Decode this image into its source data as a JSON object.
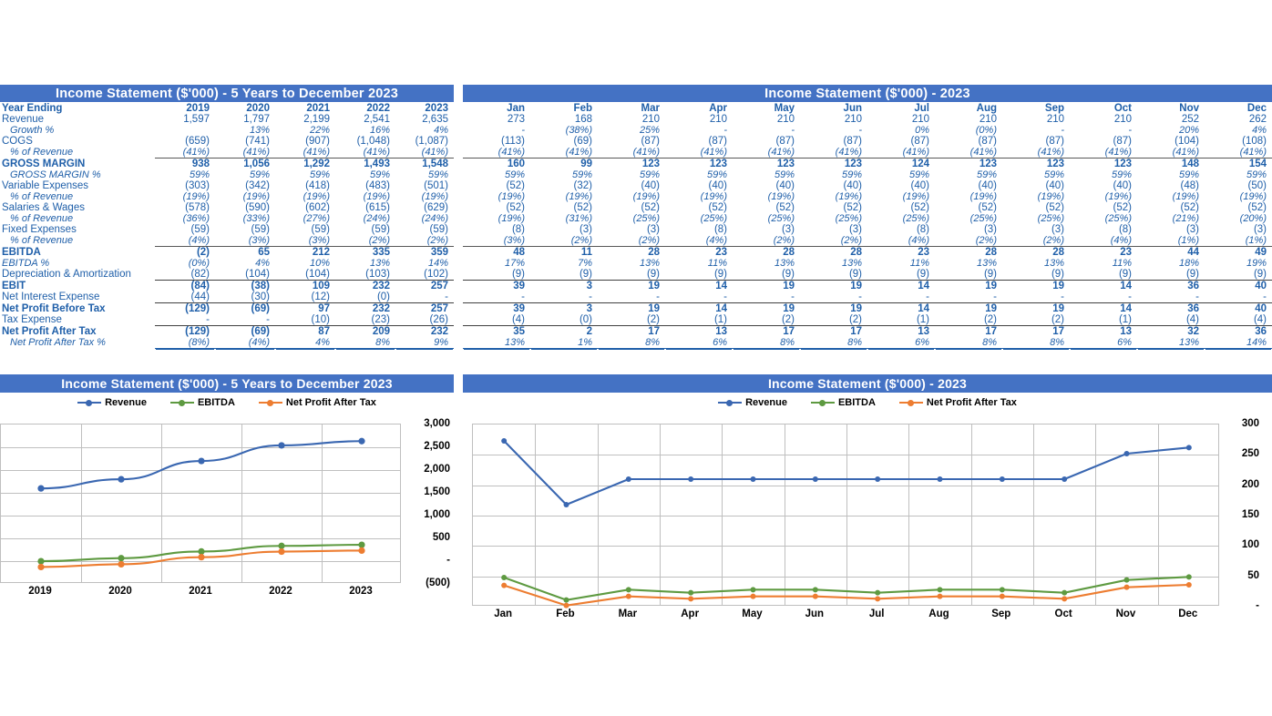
{
  "colors": {
    "header_blue": "#4472C4",
    "text_blue": "#1F5FA9",
    "revenue": "#3A67B1",
    "ebitda": "#5E9A41",
    "npat": "#ED7D31"
  },
  "annual_panel": {
    "title": "Income Statement ($'000) - 5 Years to December 2023",
    "row_header_label": "Year Ending",
    "columns": [
      "2019",
      "2020",
      "2021",
      "2022",
      "2023"
    ],
    "rows": [
      {
        "label": "Revenue",
        "style": "norm",
        "values": [
          "1,597",
          "1,797",
          "2,199",
          "2,541",
          "2,635"
        ]
      },
      {
        "label": "Growth %",
        "style": "ital-ind",
        "values": [
          "",
          "13%",
          "22%",
          "16%",
          "4%"
        ]
      },
      {
        "label": "COGS",
        "style": "norm",
        "values": [
          "(659)",
          "(741)",
          "(907)",
          "(1,048)",
          "(1,087)"
        ]
      },
      {
        "label": "% of Revenue",
        "style": "ital-ind",
        "values": [
          "(41%)",
          "(41%)",
          "(41%)",
          "(41%)",
          "(41%)"
        ]
      },
      {
        "label": "GROSS MARGIN",
        "style": "bold-top",
        "values": [
          "938",
          "1,056",
          "1,292",
          "1,493",
          "1,548"
        ]
      },
      {
        "label": "GROSS MARGIN %",
        "style": "ital-ind",
        "values": [
          "59%",
          "59%",
          "59%",
          "59%",
          "59%"
        ]
      },
      {
        "label": "Variable Expenses",
        "style": "norm",
        "values": [
          "(303)",
          "(342)",
          "(418)",
          "(483)",
          "(501)"
        ]
      },
      {
        "label": "% of Revenue",
        "style": "ital-ind",
        "values": [
          "(19%)",
          "(19%)",
          "(19%)",
          "(19%)",
          "(19%)"
        ]
      },
      {
        "label": "Salaries & Wages",
        "style": "norm",
        "values": [
          "(578)",
          "(590)",
          "(602)",
          "(615)",
          "(629)"
        ]
      },
      {
        "label": "% of Revenue",
        "style": "ital-ind",
        "values": [
          "(36%)",
          "(33%)",
          "(27%)",
          "(24%)",
          "(24%)"
        ]
      },
      {
        "label": "Fixed Expenses",
        "style": "norm",
        "values": [
          "(59)",
          "(59)",
          "(59)",
          "(59)",
          "(59)"
        ]
      },
      {
        "label": "% of Revenue",
        "style": "ital-ind",
        "values": [
          "(4%)",
          "(3%)",
          "(3%)",
          "(2%)",
          "(2%)"
        ]
      },
      {
        "label": "EBITDA",
        "style": "bold-top",
        "values": [
          "(2)",
          "65",
          "212",
          "335",
          "359"
        ]
      },
      {
        "label": "EBITDA %",
        "style": "ital",
        "values": [
          "(0%)",
          "4%",
          "10%",
          "13%",
          "14%"
        ]
      },
      {
        "label": "Depreciation & Amortization",
        "style": "norm",
        "values": [
          "(82)",
          "(104)",
          "(104)",
          "(103)",
          "(102)"
        ]
      },
      {
        "label": "EBIT",
        "style": "bold-thin",
        "values": [
          "(84)",
          "(38)",
          "109",
          "232",
          "257"
        ]
      },
      {
        "label": "Net Interest Expense",
        "style": "norm",
        "values": [
          "(44)",
          "(30)",
          "(12)",
          "(0)",
          "-"
        ]
      },
      {
        "label": "Net Profit Before Tax",
        "style": "bold-thin",
        "values": [
          "(129)",
          "(69)",
          "97",
          "232",
          "257"
        ]
      },
      {
        "label": "Tax Expense",
        "style": "norm",
        "values": [
          "-",
          "-",
          "(10)",
          "(23)",
          "(26)"
        ]
      },
      {
        "label": "Net Profit After Tax",
        "style": "bold-thin",
        "values": [
          "(129)",
          "(69)",
          "87",
          "209",
          "232"
        ]
      },
      {
        "label": "Net Profit After Tax %",
        "style": "ital-ind-dbl",
        "values": [
          "(8%)",
          "(4%)",
          "4%",
          "8%",
          "9%"
        ]
      }
    ]
  },
  "monthly_panel": {
    "title": "Income Statement ($'000) - 2023",
    "columns": [
      "Jan",
      "Feb",
      "Mar",
      "Apr",
      "May",
      "Jun",
      "Jul",
      "Aug",
      "Sep",
      "Oct",
      "Nov",
      "Dec"
    ],
    "rows": [
      {
        "label": "Revenue",
        "style": "norm",
        "values": [
          "273",
          "168",
          "210",
          "210",
          "210",
          "210",
          "210",
          "210",
          "210",
          "210",
          "252",
          "262"
        ]
      },
      {
        "label": "Growth %",
        "style": "ital-ind",
        "values": [
          "-",
          "(38%)",
          "25%",
          "-",
          "-",
          "-",
          "0%",
          "(0%)",
          "-",
          "-",
          "20%",
          "4%"
        ]
      },
      {
        "label": "COGS",
        "style": "norm",
        "values": [
          "(113)",
          "(69)",
          "(87)",
          "(87)",
          "(87)",
          "(87)",
          "(87)",
          "(87)",
          "(87)",
          "(87)",
          "(104)",
          "(108)"
        ]
      },
      {
        "label": "% of Revenue",
        "style": "ital-ind",
        "values": [
          "(41%)",
          "(41%)",
          "(41%)",
          "(41%)",
          "(41%)",
          "(41%)",
          "(41%)",
          "(41%)",
          "(41%)",
          "(41%)",
          "(41%)",
          "(41%)"
        ]
      },
      {
        "label": "GROSS MARGIN",
        "style": "bold-top",
        "values": [
          "160",
          "99",
          "123",
          "123",
          "123",
          "123",
          "124",
          "123",
          "123",
          "123",
          "148",
          "154"
        ]
      },
      {
        "label": "GROSS MARGIN %",
        "style": "ital-ind",
        "values": [
          "59%",
          "59%",
          "59%",
          "59%",
          "59%",
          "59%",
          "59%",
          "59%",
          "59%",
          "59%",
          "59%",
          "59%"
        ]
      },
      {
        "label": "Variable Expenses",
        "style": "norm",
        "values": [
          "(52)",
          "(32)",
          "(40)",
          "(40)",
          "(40)",
          "(40)",
          "(40)",
          "(40)",
          "(40)",
          "(40)",
          "(48)",
          "(50)"
        ]
      },
      {
        "label": "% of Revenue",
        "style": "ital-ind",
        "values": [
          "(19%)",
          "(19%)",
          "(19%)",
          "(19%)",
          "(19%)",
          "(19%)",
          "(19%)",
          "(19%)",
          "(19%)",
          "(19%)",
          "(19%)",
          "(19%)"
        ]
      },
      {
        "label": "Salaries & Wages",
        "style": "norm",
        "values": [
          "(52)",
          "(52)",
          "(52)",
          "(52)",
          "(52)",
          "(52)",
          "(52)",
          "(52)",
          "(52)",
          "(52)",
          "(52)",
          "(52)"
        ]
      },
      {
        "label": "% of Revenue",
        "style": "ital-ind",
        "values": [
          "(19%)",
          "(31%)",
          "(25%)",
          "(25%)",
          "(25%)",
          "(25%)",
          "(25%)",
          "(25%)",
          "(25%)",
          "(25%)",
          "(21%)",
          "(20%)"
        ]
      },
      {
        "label": "Fixed Expenses",
        "style": "norm",
        "values": [
          "(8)",
          "(3)",
          "(3)",
          "(8)",
          "(3)",
          "(3)",
          "(8)",
          "(3)",
          "(3)",
          "(8)",
          "(3)",
          "(3)"
        ]
      },
      {
        "label": "% of Revenue",
        "style": "ital-ind",
        "values": [
          "(3%)",
          "(2%)",
          "(2%)",
          "(4%)",
          "(2%)",
          "(2%)",
          "(4%)",
          "(2%)",
          "(2%)",
          "(4%)",
          "(1%)",
          "(1%)"
        ]
      },
      {
        "label": "EBITDA",
        "style": "bold-top",
        "values": [
          "48",
          "11",
          "28",
          "23",
          "28",
          "28",
          "23",
          "28",
          "28",
          "23",
          "44",
          "49"
        ]
      },
      {
        "label": "EBITDA %",
        "style": "ital",
        "values": [
          "17%",
          "7%",
          "13%",
          "11%",
          "13%",
          "13%",
          "11%",
          "13%",
          "13%",
          "11%",
          "18%",
          "19%"
        ]
      },
      {
        "label": "Depreciation & Amortization",
        "style": "norm",
        "values": [
          "(9)",
          "(9)",
          "(9)",
          "(9)",
          "(9)",
          "(9)",
          "(9)",
          "(9)",
          "(9)",
          "(9)",
          "(9)",
          "(9)"
        ]
      },
      {
        "label": "EBIT",
        "style": "bold-thin",
        "values": [
          "39",
          "3",
          "19",
          "14",
          "19",
          "19",
          "14",
          "19",
          "19",
          "14",
          "36",
          "40"
        ]
      },
      {
        "label": "Net Interest Expense",
        "style": "norm",
        "values": [
          "-",
          "-",
          "-",
          "-",
          "-",
          "-",
          "-",
          "-",
          "-",
          "-",
          "-",
          "-"
        ]
      },
      {
        "label": "Net Profit Before Tax",
        "style": "bold-thin",
        "values": [
          "39",
          "3",
          "19",
          "14",
          "19",
          "19",
          "14",
          "19",
          "19",
          "14",
          "36",
          "40"
        ]
      },
      {
        "label": "Tax Expense",
        "style": "norm",
        "values": [
          "(4)",
          "(0)",
          "(2)",
          "(1)",
          "(2)",
          "(2)",
          "(1)",
          "(2)",
          "(2)",
          "(1)",
          "(4)",
          "(4)"
        ]
      },
      {
        "label": "Net Profit After Tax",
        "style": "bold-thin",
        "values": [
          "35",
          "2",
          "17",
          "13",
          "17",
          "17",
          "13",
          "17",
          "17",
          "13",
          "32",
          "36"
        ]
      },
      {
        "label": "Net Profit After Tax %",
        "style": "ital-ind-dbl",
        "values": [
          "13%",
          "1%",
          "8%",
          "6%",
          "8%",
          "8%",
          "6%",
          "8%",
          "8%",
          "6%",
          "13%",
          "14%"
        ]
      }
    ]
  },
  "annual_chart_panel": {
    "title": "Income Statement ($'000) - 5 Years to December 2023",
    "legend": [
      "Revenue",
      "EBITDA",
      "Net Profit After Tax"
    ]
  },
  "monthly_chart_panel": {
    "title": "Income Statement ($'000) - 2023",
    "legend": [
      "Revenue",
      "EBITDA",
      "Net Profit After Tax"
    ]
  },
  "chart_data": [
    {
      "type": "line",
      "id": "annual",
      "title": "Income Statement ($'000) - 5 Years to December 2023",
      "categories": [
        "2019",
        "2020",
        "2021",
        "2022",
        "2023"
      ],
      "series": [
        {
          "name": "Revenue",
          "color": "#3A67B1",
          "values": [
            1597,
            1797,
            2199,
            2541,
            2635
          ]
        },
        {
          "name": "EBITDA",
          "color": "#5E9A41",
          "values": [
            -2,
            65,
            212,
            335,
            359
          ]
        },
        {
          "name": "Net Profit After Tax",
          "color": "#ED7D31",
          "values": [
            -129,
            -69,
            87,
            209,
            232
          ]
        }
      ],
      "ylim": [
        -500,
        3000
      ],
      "ytick_step": 500,
      "ytick_labels": [
        "3,000",
        "2,500",
        "2,000",
        "1,500",
        "1,000",
        "500",
        "-",
        "(500)"
      ],
      "xlabel": "",
      "ylabel": "",
      "grid": true,
      "smooth": true,
      "legend_position": "top"
    },
    {
      "type": "line",
      "id": "monthly",
      "title": "Income Statement ($'000) - 2023",
      "categories": [
        "Jan",
        "Feb",
        "Mar",
        "Apr",
        "May",
        "Jun",
        "Jul",
        "Aug",
        "Sep",
        "Oct",
        "Nov",
        "Dec"
      ],
      "series": [
        {
          "name": "Revenue",
          "color": "#3A67B1",
          "values": [
            273,
            168,
            210,
            210,
            210,
            210,
            210,
            210,
            210,
            210,
            252,
            262
          ]
        },
        {
          "name": "EBITDA",
          "color": "#5E9A41",
          "values": [
            48,
            11,
            28,
            23,
            28,
            28,
            23,
            28,
            28,
            23,
            44,
            49
          ]
        },
        {
          "name": "Net Profit After Tax",
          "color": "#ED7D31",
          "values": [
            35,
            2,
            17,
            13,
            17,
            17,
            13,
            17,
            17,
            13,
            32,
            36
          ]
        }
      ],
      "ylim": [
        0,
        300
      ],
      "ytick_step": 50,
      "ytick_labels": [
        "300",
        "250",
        "200",
        "150",
        "100",
        "50",
        "-"
      ],
      "xlabel": "",
      "ylabel": "",
      "grid": true,
      "smooth": false,
      "legend_position": "top"
    }
  ]
}
